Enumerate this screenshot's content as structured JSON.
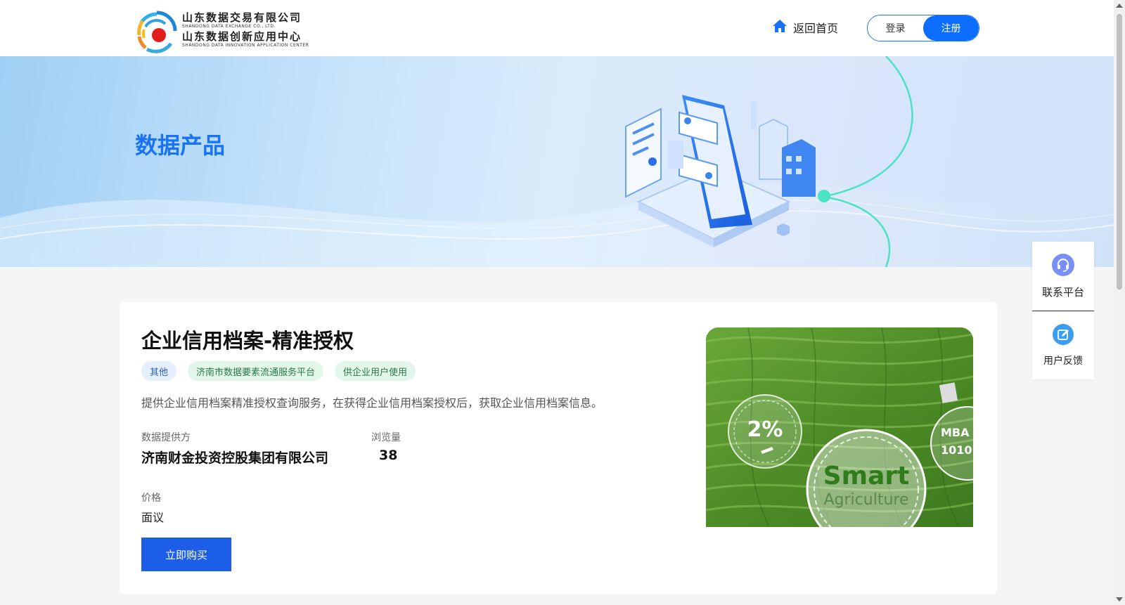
{
  "header": {
    "logo": {
      "line1_cn": "山东数据交易有限公司",
      "line1_en": "SHANDONG DATA EXCHANGE CO., LTD.",
      "line2_cn": "山东数据创新应用中心",
      "line2_en": "SHANDONG DATA INNOVATION APPLICATION CENTER"
    },
    "home_label": "返回首页",
    "home_icon": "home-icon",
    "login_label": "登录",
    "register_label": "注册"
  },
  "banner": {
    "title": "数据产品"
  },
  "product": {
    "title": "企业信用档案-精准授权",
    "tags": [
      "其他",
      "济南市数据要素流通服务平台",
      "供企业用户使用"
    ],
    "description": "提供企业信用档案精准授权查询服务，在获得企业信用档案授权后，获取企业信用档案信息。",
    "provider_label": "数据提供方",
    "provider_value": "济南财金投资控股集团有限公司",
    "views_label": "浏览量",
    "views_value": "38",
    "price_label": "价格",
    "price_value": "面议",
    "buy_label": "立即购买",
    "image_texts": {
      "percent": "2%",
      "smart": "Smart",
      "agriculture": "Agriculture",
      "mba": "MBA",
      "binary": "1010"
    }
  },
  "side_panel": {
    "contact_label": "联系平台",
    "contact_icon": "headset-icon",
    "feedback_label": "用户反馈",
    "feedback_icon": "edit-icon"
  },
  "colors": {
    "brand_blue": "#1a73f5",
    "button_blue": "#1d5ee8",
    "tag_blue_bg": "#e6effc",
    "tag_green_bg": "#e2f6ea"
  }
}
